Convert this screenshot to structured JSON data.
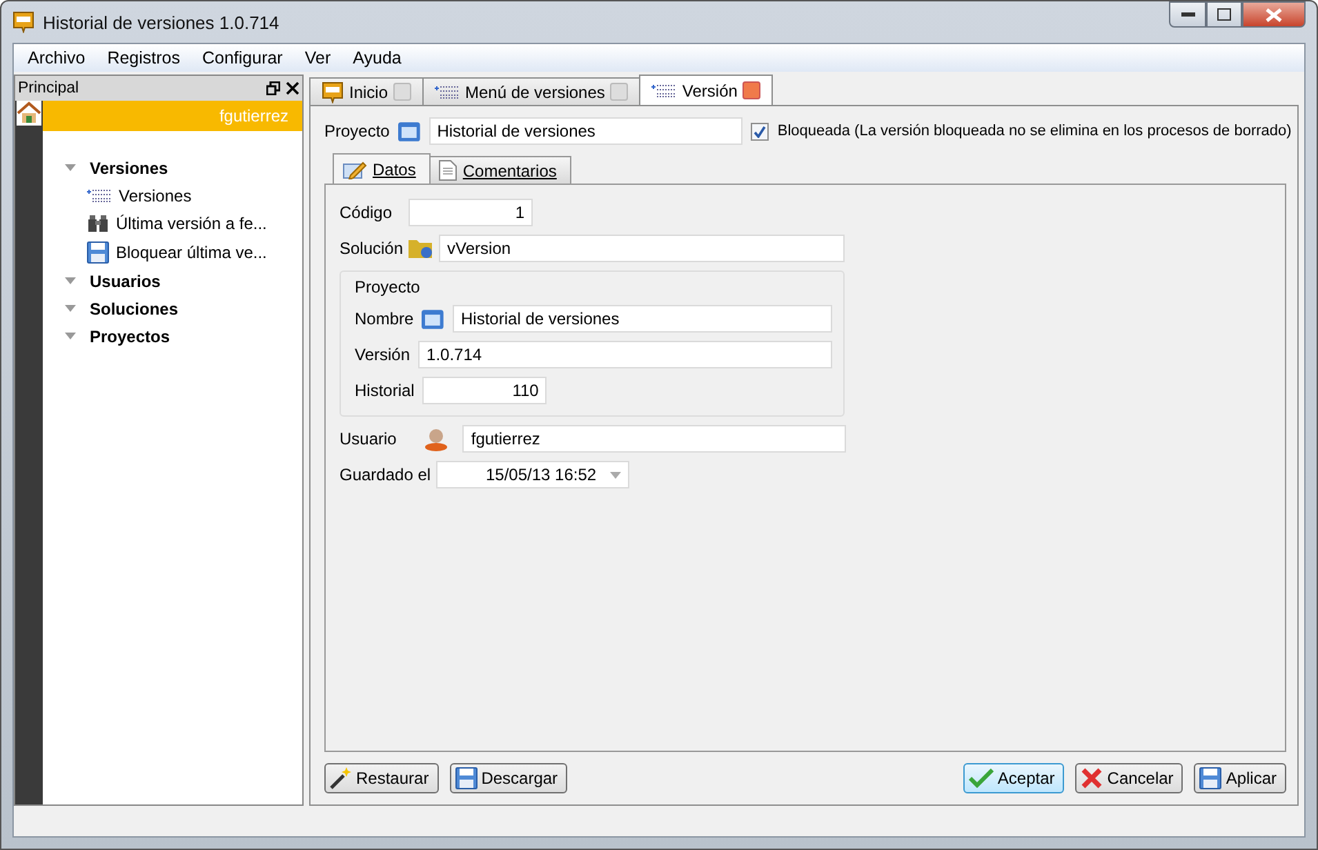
{
  "window": {
    "title": "Historial de versiones 1.0.714"
  },
  "menu": [
    {
      "label": "Archivo"
    },
    {
      "label": "Registros"
    },
    {
      "label": "Configurar"
    },
    {
      "label": "Ver"
    },
    {
      "label": "Ayuda"
    }
  ],
  "sidebar": {
    "title": "Principal",
    "user": "fgutierrez",
    "groups": [
      {
        "label": "Versiones",
        "expanded": true,
        "children": [
          {
            "label": "Versiones",
            "kind": "list"
          },
          {
            "label": "Última versión a fe...",
            "kind": "binoculars"
          },
          {
            "label": "Bloquear última ve...",
            "kind": "disk"
          }
        ]
      },
      {
        "label": "Usuarios",
        "expanded": true
      },
      {
        "label": "Soluciones",
        "expanded": true
      },
      {
        "label": "Proyectos",
        "expanded": true
      }
    ]
  },
  "tabs": [
    {
      "label": "Inicio",
      "kind": "logo",
      "selected": false
    },
    {
      "label": "Menú de versiones",
      "kind": "list",
      "selected": false
    },
    {
      "label": "Versión",
      "kind": "list",
      "selected": true
    }
  ],
  "project": {
    "label": "Proyecto",
    "value": "Historial de versiones",
    "locked": {
      "label": "Bloqueada (La versión bloqueada no se elimina en los procesos de borrado)",
      "checked": true
    }
  },
  "subtabs": [
    {
      "label": "Datos",
      "kind": "pencil",
      "selected": true
    },
    {
      "label": "Comentarios",
      "kind": "page",
      "selected": false
    }
  ],
  "fields": {
    "codigo": {
      "label": "Código",
      "value": "1"
    },
    "solucion": {
      "label": "Solución",
      "value": "vVersion"
    },
    "proyecto_group": {
      "title": "Proyecto",
      "nombre": {
        "label": "Nombre",
        "value": "Historial de versiones"
      },
      "version": {
        "label": "Versión",
        "value": "1.0.714"
      },
      "historial": {
        "label": "Historial",
        "value": "110"
      }
    },
    "usuario": {
      "label": "Usuario",
      "value": "fgutierrez"
    },
    "guardado": {
      "label": "Guardado el",
      "value": "15/05/13 16:52"
    }
  },
  "buttons_left": [
    {
      "label": "Restaurar",
      "kind": "wand",
      "default": false
    },
    {
      "label": "Descargar",
      "kind": "disk",
      "default": false
    }
  ],
  "buttons_right": [
    {
      "label": "Aceptar",
      "kind": "check",
      "default": true
    },
    {
      "label": "Cancelar",
      "kind": "cross",
      "default": false
    },
    {
      "label": "Aplicar",
      "kind": "disk",
      "default": false
    }
  ]
}
